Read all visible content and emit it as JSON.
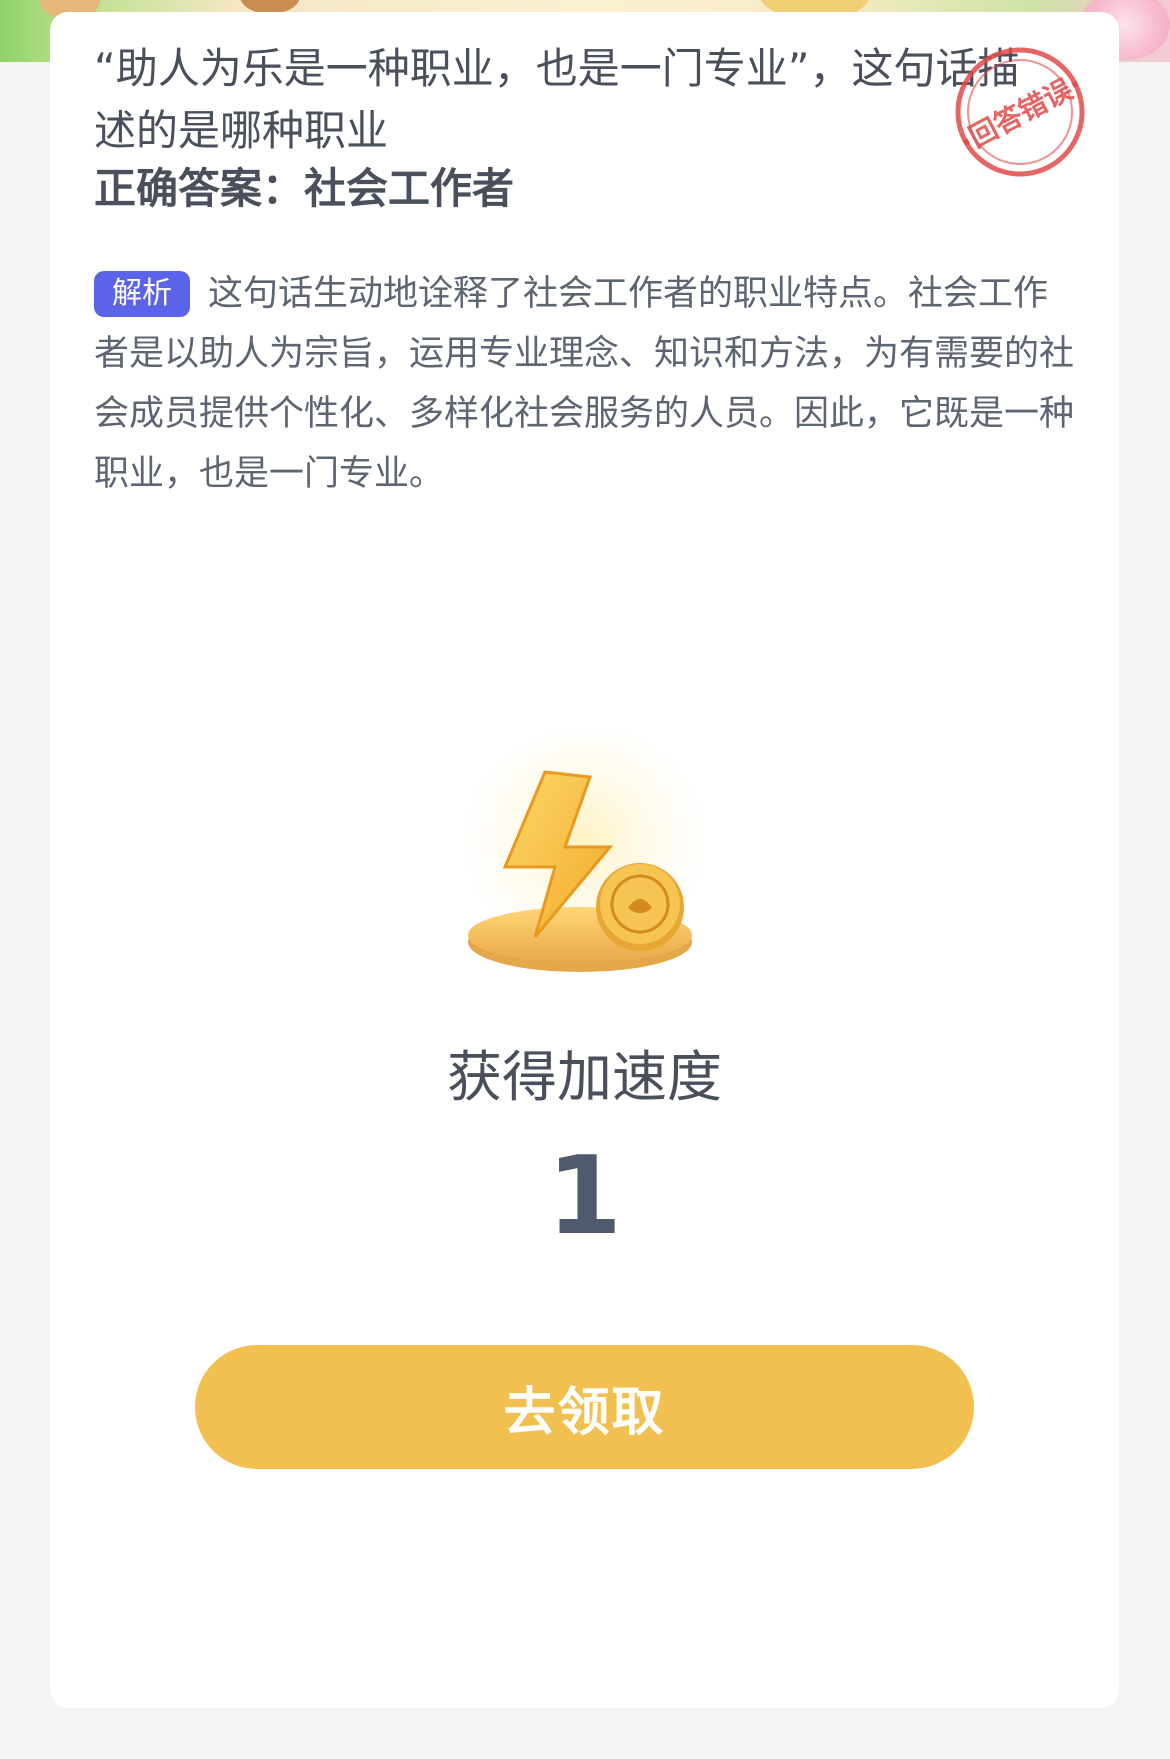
{
  "question": {
    "text": "“助人为乐是一种职业，也是一门专业”，这句话描述的是哪种职业",
    "answer": "正确答案：社会工作者"
  },
  "stamp": {
    "text": "·回答错误·",
    "color": "#e24a4a"
  },
  "analysis": {
    "tag": "解析",
    "text": "这句话生动地诠释了社会工作者的职业特点。社会工作者是以助人为宗旨，运用专业理念、知识和方法，为有需要的社会成员提供个性化、多样化社会服务的人员。因此，它既是一种职业，也是一门专业。"
  },
  "reward": {
    "icon": "lightning-coin-icon",
    "title": "获得加速度",
    "value": "1"
  },
  "button": {
    "label": "去领取"
  },
  "colors": {
    "accent": "#f2c050",
    "tag": "#5b63e8",
    "text": "#4a4f5c"
  }
}
